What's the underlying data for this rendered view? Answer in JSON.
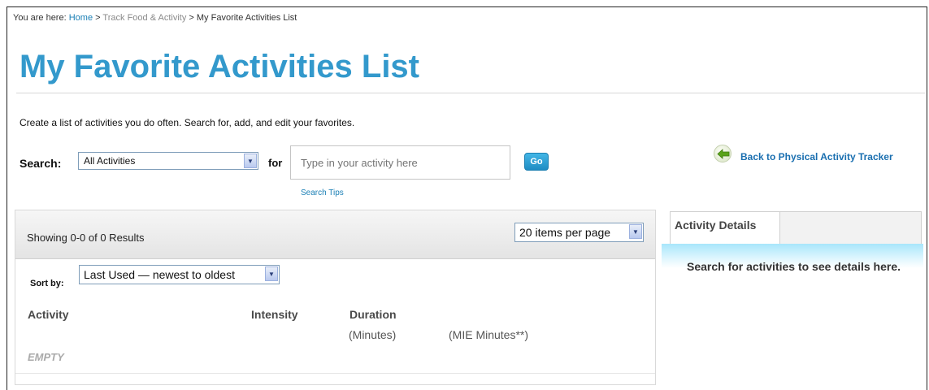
{
  "breadcrumb": {
    "prefix": "You are here:",
    "home": "Home",
    "sep1": ">",
    "track": "Track Food & Activity",
    "sep2": ">",
    "current": "My Favorite Activities List"
  },
  "page_title": "My Favorite Activities List",
  "intro_text": "Create a list of activities you do often. Search for, add, and edit your favorites.",
  "search": {
    "label": "Search:",
    "category_value": "All Activities",
    "for_label": "for",
    "input_placeholder": "Type in your activity here",
    "go_label": "Go",
    "tips_label": "Search Tips"
  },
  "back_link": "Back to Physical Activity Tracker",
  "results": {
    "showing": "Showing 0-0 of 0 Results",
    "per_page": "20 items per page",
    "sort_label": "Sort by:",
    "sort_value": "Last Used — newest to oldest",
    "columns": {
      "activity": "Activity",
      "intensity": "Intensity",
      "duration": "Duration",
      "minutes": "(Minutes)",
      "mie_minutes": "(MIE Minutes**)"
    },
    "empty_text": "EMPTY"
  },
  "details": {
    "tab_label": "Activity Details",
    "message": "Search for activities to see details here."
  },
  "colors": {
    "title": "#3399cc",
    "link": "#1a7fb5",
    "go_button": "#2a9fd6",
    "details_band": "#a8e6fb"
  },
  "icons": {
    "back": "green-left-arrow-icon",
    "dropdown": "chevron-down-icon"
  }
}
